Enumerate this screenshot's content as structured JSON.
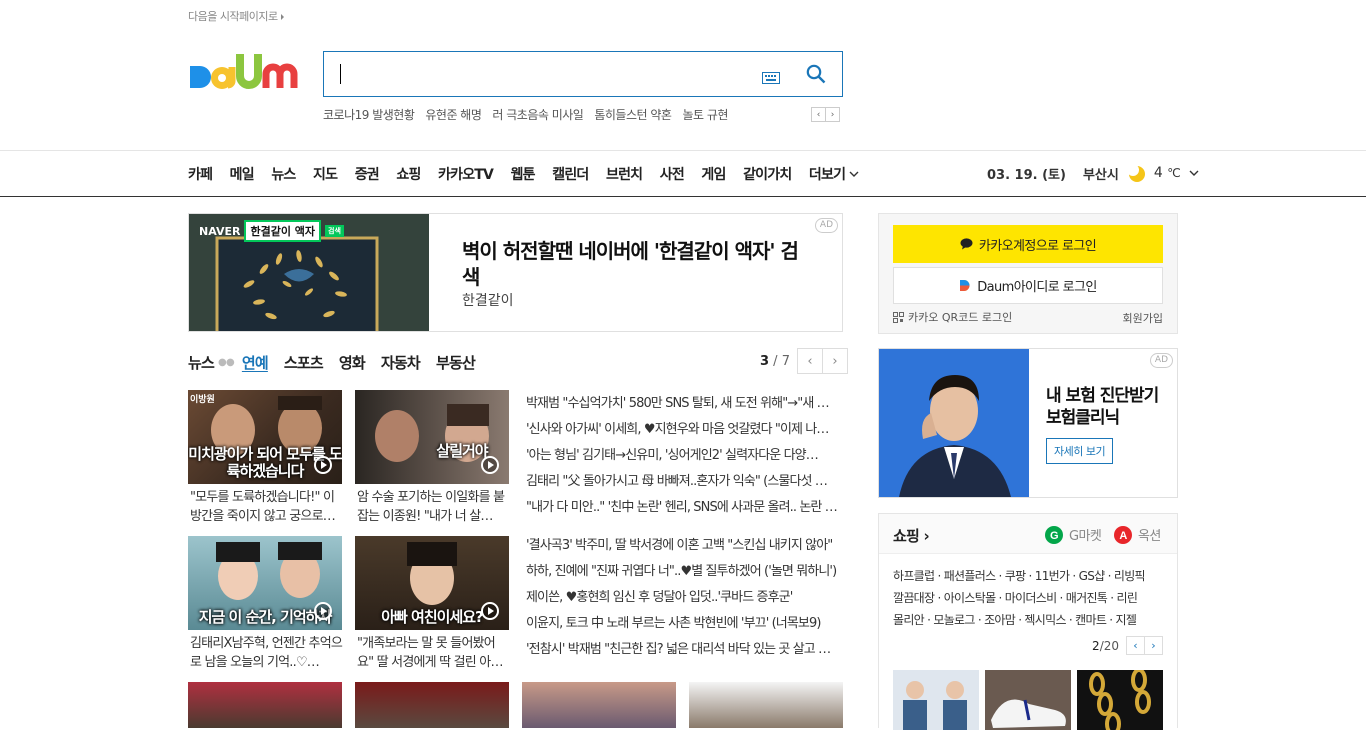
{
  "top": {
    "start_link": "다음을 시작페이지로"
  },
  "logo": {
    "text": "Daum"
  },
  "search": {
    "placeholder": "",
    "keyboard_icon": "keyboard-icon",
    "search_icon": "search-icon"
  },
  "trending": [
    "코로나19 발생현황",
    "유현준 해명",
    "러 극초음속 미사일",
    "톰히들스턴 약혼",
    "놀토 규현"
  ],
  "nav": {
    "items": [
      "카페",
      "메일",
      "뉴스",
      "지도",
      "증권",
      "쇼핑",
      "카카오TV",
      "웹툰",
      "캘린더",
      "브런치",
      "사전",
      "게임",
      "같이가치"
    ],
    "more": "더보기"
  },
  "weather": {
    "date": "03. 19. (토)",
    "city": "부산시",
    "temp": "4",
    "unit": "℃"
  },
  "ad_main": {
    "tag": "AD",
    "brand": "NAVER",
    "search_box": "한결같이 액자",
    "search_button": "검색",
    "title": "벽이 허전할땐 네이버에 '한결같이 액자' 검색",
    "subtitle": "한결같이"
  },
  "news_tabs": {
    "items": [
      "뉴스",
      "연예",
      "스포츠",
      "영화",
      "자동차",
      "부동산"
    ],
    "active": "연예",
    "page_current": "3",
    "page_sep": " / ",
    "page_total": "7"
  },
  "thumbs": [
    {
      "overlay": "미치광이가 되어 모두를 도륙하겠습니다",
      "caption": "\"모두를 도륙하겠습니다!\" 이방간을 죽이지 않고 궁으로…",
      "tag": "이방원"
    },
    {
      "overlay": "살릴거야",
      "caption": "암 수술 포기하는 이일화를 붙잡는 이종원! \"내가 너 살…",
      "tag": ""
    },
    {
      "overlay": "지금 이 순간, 기억하자",
      "caption": "김태리X남주혁, 언젠간 추억으로 남을 오늘의 기억..♡…",
      "tag": ""
    },
    {
      "overlay": "아빠 여친이세요?",
      "caption": "\"개족보라는 말 못 들어봤어요\" 딸 서경에게 딱 걸린 아…",
      "tag": ""
    }
  ],
  "headlines_1": [
    "박재범 \"수십억가치' 580만 SNS 탈퇴, 새 도전 위해\"→\"새 …",
    "'신사와 아가씨' 이세희, ♥지현우와 마음 엇갈렸다 \"이제 나…",
    "'아는 형님' 김기태→신유미, '싱어게인2' 실력자다운 다양…",
    "김태리 \"父 돌아가시고 母 바빠져..혼자가 익숙\" (스물다섯 …",
    "\"내가 다 미안..\" '친中 논란' 헨리, SNS에 사과문 올려.. 논란 …"
  ],
  "headlines_2": [
    "'결사곡3' 박주미, 딸 박서경에 이혼 고백 \"스킨십 내키지 않아\"",
    "하하, 진예에 \"진짜 귀엽다 너\"..♥별 질투하겠어 ('놀면 뭐하니')",
    "제이쓴, ♥홍현희 임신 후 덩달아 입덧..'쿠바드 증후군'",
    "이윤지, 토크 中 노래 부르는 사촌 박현빈에 '부끄' (너목보9)",
    "'전참시' 박재범 \"친근한 집? 넓은 대리석 바닥 있는 곳 살고 …"
  ],
  "login": {
    "kakao": "카카오계정으로 로그인",
    "daum": "Daum아이디로 로그인",
    "qr": "카카오 QR코드 로그인",
    "join": "회원가입"
  },
  "ad_side": {
    "tag": "AD",
    "title": "내 보험 진단받기 보험클리닉",
    "button": "자세히 보기"
  },
  "shopping": {
    "title": "쇼핑",
    "gmarket": "G마켓",
    "auction": "옥션",
    "links": [
      "하프클럽 · 패션플러스 · 쿠팡 · 11번가 · GS샵 · 리빙픽",
      "깔끔대장 · 아이스탁몰 · 마이더스비 · 매거진톡 · 리린",
      "몰리안 · 모놀로그 · 조아맘 · 젝시믹스 · 캔마트 · 지젤"
    ],
    "page_current": "2",
    "page_total": "/20"
  },
  "colors": {
    "accent": "#1a76b8",
    "kakao_yellow": "#fee500",
    "naver_green": "#03c75a"
  }
}
